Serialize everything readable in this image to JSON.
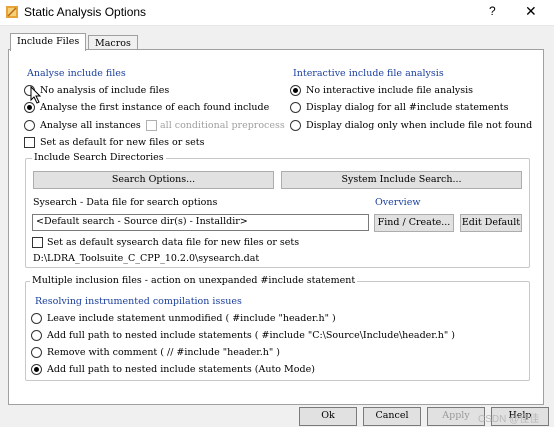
{
  "window": {
    "title": "Static Analysis Options",
    "help_symbol": "?",
    "close_symbol": "✕"
  },
  "tabs": [
    {
      "label": "Include Files",
      "active": true
    },
    {
      "label": "Macros",
      "active": false
    }
  ],
  "analyse": {
    "title": "Analyse include files",
    "options": [
      {
        "label": "No analysis of include files",
        "selected": false
      },
      {
        "label": "Analyse the first instance of each found include",
        "selected": true
      },
      {
        "label": "Analyse all instances",
        "selected": false
      }
    ],
    "all_conditional_label": "all conditional preprocess",
    "default_label": "Set as default for new files or sets"
  },
  "interactive": {
    "title": "Interactive include file analysis",
    "options": [
      {
        "label": "No interactive include file analysis",
        "selected": true
      },
      {
        "label": "Display dialog for all #include statements",
        "selected": false
      },
      {
        "label": "Display dialog only when include file not found",
        "selected": false
      }
    ]
  },
  "search_dirs": {
    "title": "Include Search Directories",
    "search_options_button": "Search Options...",
    "system_include_button": "System Include Search...",
    "sysearch_label": "Sysearch - Data file for search options",
    "overview_link": "Overview",
    "sysearch_value": "<Default search - Source dir(s) - Installdir>",
    "find_create_button": "Find / Create...",
    "edit_default_button": "Edit Default",
    "default_sysearch_label": "Set as default sysearch data file for new files or sets",
    "sysearch_path": "D:\\LDRA_Toolsuite_C_CPP_10.2.0\\sysearch.dat"
  },
  "multiple": {
    "title": "Multiple inclusion files - action on unexpanded #include statement",
    "subtitle": "Resolving instrumented compilation issues",
    "options": [
      {
        "label": "Leave include statement unmodified ( #include \"header.h\" )",
        "selected": false
      },
      {
        "label": "Add full path to nested include statements ( #include \"C:\\Source\\Include\\header.h\" )",
        "selected": false
      },
      {
        "label": "Remove with comment ( // #include \"header.h\" )",
        "selected": false
      },
      {
        "label": "Add full path to nested include statements (Auto Mode)",
        "selected": true
      }
    ]
  },
  "footer": {
    "ok": "Ok",
    "cancel": "Cancel",
    "apply": "Apply",
    "help": "Help",
    "watermark": "CSDN @佳佳"
  }
}
